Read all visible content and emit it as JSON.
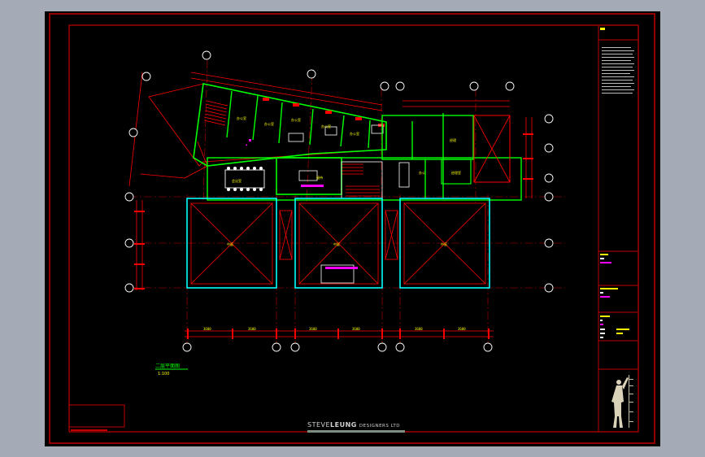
{
  "drawing": {
    "plan_title": "二层平面图",
    "plan_scale": "1:100",
    "company_brand_prefix": "STEVE",
    "company_brand_name": "LEUNG",
    "company_brand_suffix": "DESIGNERS LTD"
  },
  "colors": {
    "background": "#000000",
    "border": "#ff0000",
    "walls_green": "#00ff00",
    "walls_cyan": "#00ffff",
    "text_yellow": "#ffff00",
    "text_magenta": "#ff00ff",
    "frame_gray": "#a4abb7"
  },
  "icons": {
    "logo": "modulor-figure-icon",
    "axis_marker": "grid-axis-bubble-icon"
  }
}
